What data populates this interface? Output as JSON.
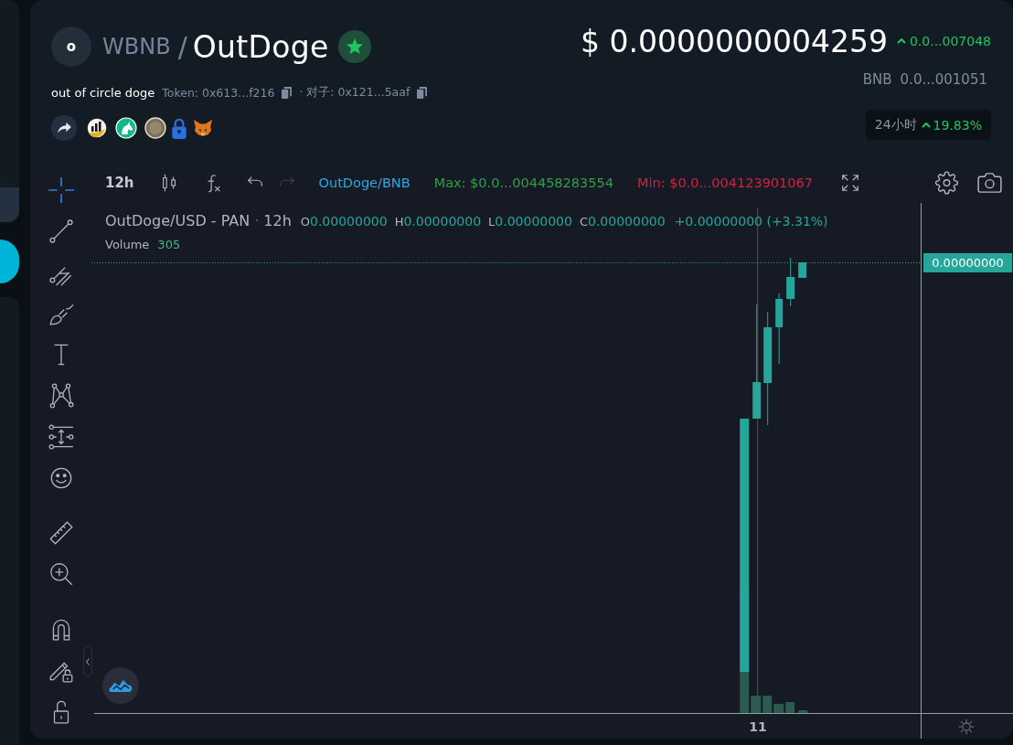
{
  "token": {
    "avatar": "o",
    "quote": "WBNB",
    "separator": "/",
    "name": "OutDoge",
    "favorite": true,
    "full_name": "out of circle doge",
    "token_address": "Token: 0x613...f216",
    "pair_address": "· 对子: 0x121...5aaf"
  },
  "price": {
    "usd": "$ 0.0000000004259",
    "change": "0.0...007048",
    "change_up": true,
    "native_label": "BNB",
    "native_value": "0.0...001051"
  },
  "change_24h": {
    "label": "24小时",
    "value": "19.83%",
    "up": true
  },
  "toolbar": {
    "interval": "12h",
    "undo_disabled": false,
    "redo_disabled": true,
    "pair": "OutDoge/BNB",
    "max": "Max: $0.0...004458283554",
    "min": "Min: $0.0...004123901067"
  },
  "tool_groups": [
    [
      {
        "kind": "crosshair",
        "selected": true
      },
      {
        "kind": "trend-line",
        "selected": false
      },
      {
        "kind": "pitchfork",
        "selected": false
      },
      {
        "kind": "brush",
        "selected": false
      },
      {
        "kind": "text",
        "selected": false
      },
      {
        "kind": "pattern",
        "selected": false
      },
      {
        "kind": "forecast",
        "selected": false
      },
      {
        "kind": "emoji",
        "selected": false
      }
    ],
    [
      {
        "kind": "ruler",
        "selected": false
      },
      {
        "kind": "zoom",
        "selected": false
      }
    ],
    [
      {
        "kind": "magnet",
        "selected": false
      },
      {
        "kind": "lock-drawings",
        "selected": false
      },
      {
        "kind": "lock",
        "selected": false
      }
    ]
  ],
  "legend": {
    "symbol": "OutDoge/USD - PAN",
    "separator": "·",
    "interval": "12h",
    "ohlc": [
      {
        "key": "O",
        "value": "0.00000000"
      },
      {
        "key": "H",
        "value": "0.00000000"
      },
      {
        "key": "L",
        "value": "0.00000000"
      },
      {
        "key": "C",
        "value": "0.00000000"
      }
    ],
    "change": "+0.00000000 (+3.31%)",
    "volume_label": "Volume",
    "volume_value": "305"
  },
  "chart": {
    "last_price": "0.00000000",
    "time_label": "11"
  }
}
